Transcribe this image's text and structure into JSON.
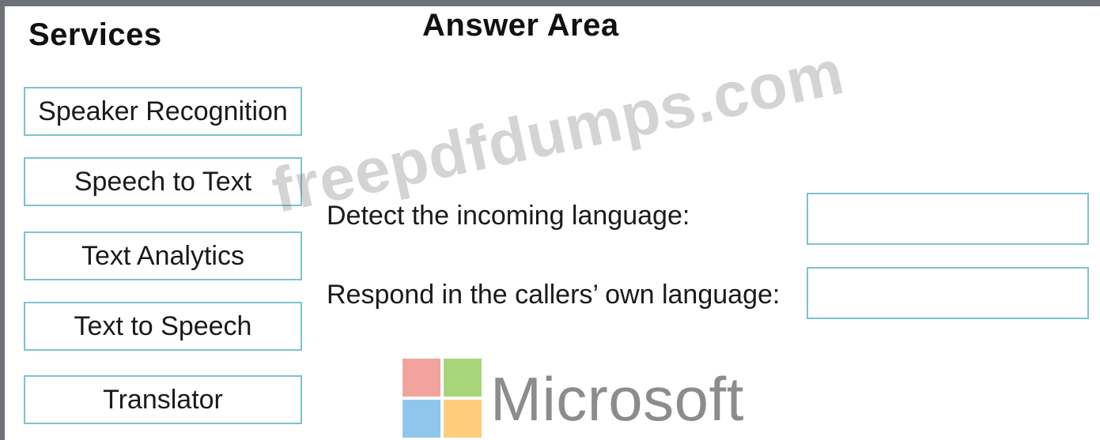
{
  "headings": {
    "services": "Services",
    "answer_area": "Answer Area"
  },
  "services": [
    {
      "label": "Speaker Recognition"
    },
    {
      "label": "Speech to Text"
    },
    {
      "label": "Text Analytics"
    },
    {
      "label": "Text to Speech"
    },
    {
      "label": "Translator"
    }
  ],
  "prompts": [
    {
      "label": "Detect the incoming language:",
      "value": ""
    },
    {
      "label": "Respond in the callers’ own language:",
      "value": ""
    }
  ],
  "watermark": "freepdfdumps.com",
  "logo": {
    "word": "Microsoft",
    "icon": "microsoft-logo-icon",
    "colors": {
      "red": "#f2a39e",
      "green": "#a7d67a",
      "blue": "#8fc6ec",
      "yellow": "#ffcd7d"
    }
  },
  "colors": {
    "border": "#7cc3cf",
    "frame": "#6f7277"
  }
}
